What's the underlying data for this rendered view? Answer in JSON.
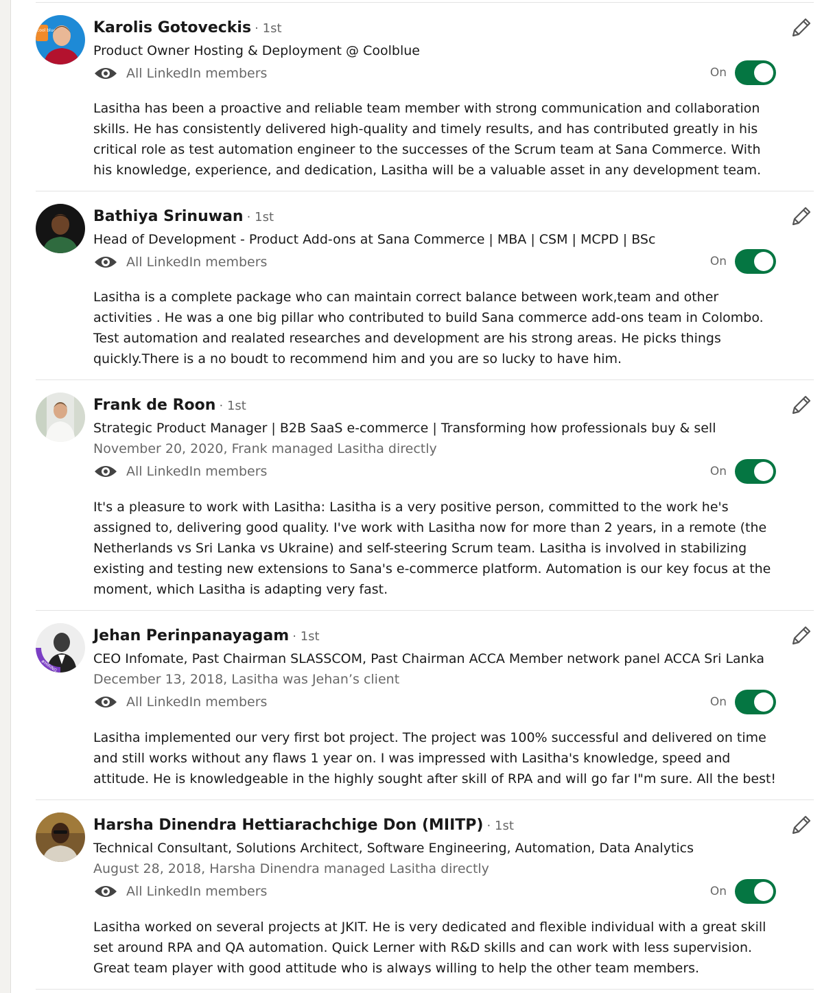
{
  "recommendations": [
    {
      "name": "Karolis Gotoveckis",
      "degree": "· 1st",
      "headline": "Product Owner Hosting & Deployment @ Coolblue",
      "meta": "",
      "visibility": "All LinkedIn members",
      "toggle_label": "On",
      "text": "Lasitha has been a proactive and reliable team member with strong communication and collaboration skills. He has consistently delivered high-quality and timely results, and has contributed greatly in his critical role as test automation engineer to the successes of the Scrum team at Sana Commerce. With his knowledge, experience, and dedication, Lasitha will be a valuable asset in any development team.",
      "avatar_badge": "cool blue"
    },
    {
      "name": "Bathiya Srinuwan",
      "degree": "· 1st",
      "headline": "Head of Development - Product Add-ons at Sana Commerce | MBA | CSM | MCPD | BSc",
      "meta": "",
      "visibility": "All LinkedIn members",
      "toggle_label": "On",
      "text": "Lasitha is a complete package who can maintain correct balance between work,team and other activities . He was a one big pillar who contributed to build Sana commerce add-ons team in Colombo. Test automation and realated researches and development are his strong areas. He picks things quickly.There is a no boudt to recommend him and you are so lucky to have him."
    },
    {
      "name": "Frank de Roon",
      "degree": "· 1st",
      "headline": "Strategic Product Manager | B2B SaaS e-commerce | Transforming how professionals buy & sell",
      "meta": "November 20, 2020, Frank managed Lasitha directly",
      "visibility": "All LinkedIn members",
      "toggle_label": "On",
      "text": "It's a pleasure to work with Lasitha: Lasitha is a very positive person, committed to the work he's assigned to, delivering good quality. I've work with Lasitha now for more than 2 years, in a remote (the Netherlands vs Sri Lanka vs Ukraine) and self-steering Scrum team. Lasitha is involved in stabilizing existing and testing new extensions to Sana's e-commerce platform. Automation is our key focus at the moment, which Lasitha is adapting very fast."
    },
    {
      "name": "Jehan Perinpanayagam",
      "degree": "· 1st",
      "headline": "CEO Infomate, Past Chairman SLASSCOM, Past Chairman ACCA Member network panel ACCA Sri Lanka",
      "meta": "December 13, 2018, Lasitha was Jehan’s client",
      "visibility": "All LinkedIn members",
      "toggle_label": "On",
      "text": "Lasitha implemented our very first bot project. The project was 100% successful and delivered on time and still works without any flaws 1 year on. I was impressed with Lasitha's knowledge, speed and attitude. He is knowledgeable in the highly sought after skill of RPA and will go far I\"m sure. All the best!",
      "avatar_badge": "#HIRING"
    },
    {
      "name": "Harsha Dinendra Hettiarachchige Don (MIITP)",
      "degree": "· 1st",
      "headline": "Technical Consultant, Solutions Architect, Software Engineering, Automation, Data Analytics",
      "meta": "August 28, 2018, Harsha Dinendra managed Lasitha directly",
      "visibility": "All LinkedIn members",
      "toggle_label": "On",
      "text": "Lasitha worked on several projects at JKIT. He is very dedicated and flexible individual with a great skill set around RPA and QA automation. Quick Lerner with R&D skills and can work with less supervision. Great team player with good attitude who is always willing to help the other team members."
    }
  ],
  "icons": {
    "visibility": "eye-icon",
    "edit": "pencil-icon"
  },
  "colors": {
    "toggle_on": "#057642",
    "divider": "#e3e3e3"
  }
}
